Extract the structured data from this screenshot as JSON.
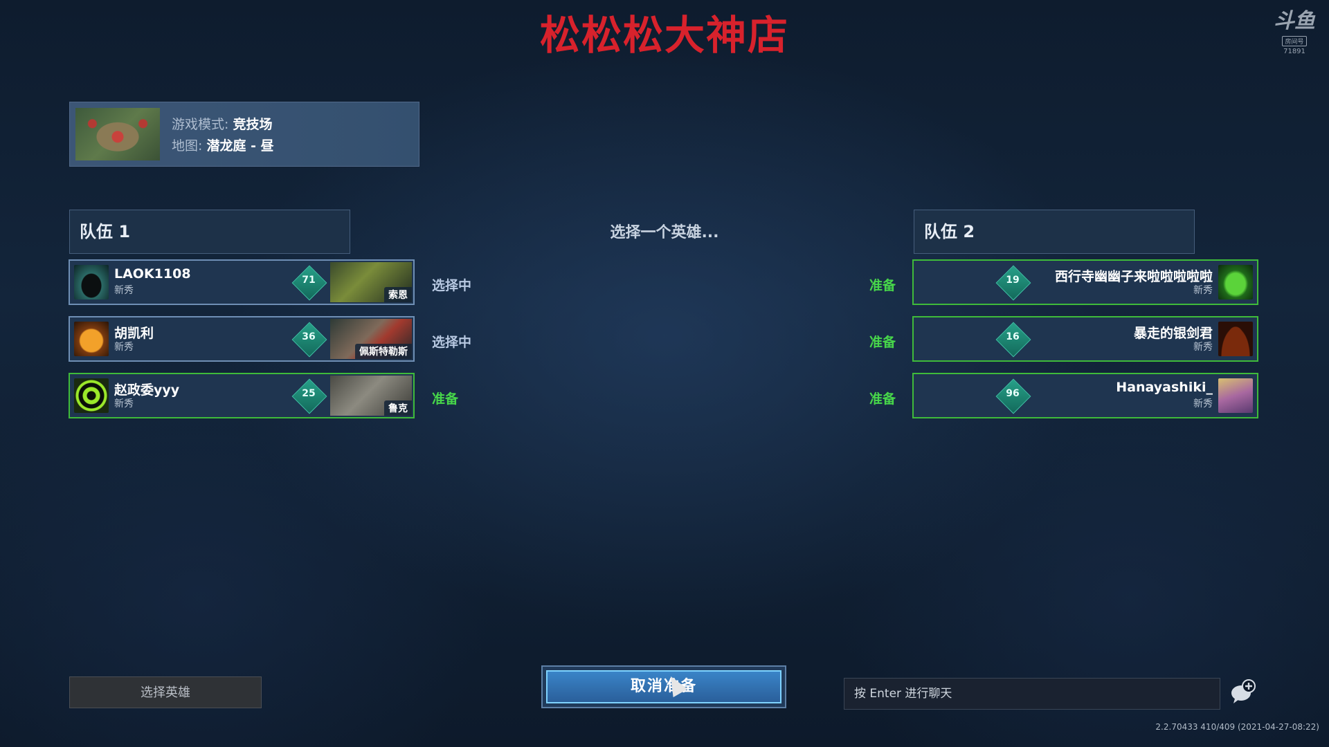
{
  "stream": {
    "title": "松松松大神店"
  },
  "watermark": {
    "logo_text": "斗鱼",
    "sub": "房间号",
    "room_id": "71891"
  },
  "game_info": {
    "mode_label": "游戏模式: ",
    "mode_value": "竞技场",
    "map_label": "地图: ",
    "map_value": "潜龙庭 - 昼"
  },
  "center": {
    "prompt": "选择一个英雄..."
  },
  "team1": {
    "header": "队伍 1",
    "players": [
      {
        "name": "LAOK1108",
        "rank": "新秀",
        "level": "71",
        "hero": "索恩",
        "status": "选择中",
        "status_type": "selecting",
        "avatar_icon": "grin-avatar-icon"
      },
      {
        "name": "胡凯利",
        "rank": "新秀",
        "level": "36",
        "hero": "佩斯特勒斯",
        "status": "选择中",
        "status_type": "selecting",
        "avatar_icon": "pumpkin-avatar-icon"
      },
      {
        "name": "赵政委yyy",
        "rank": "新秀",
        "level": "25",
        "hero": "鲁克",
        "status": "准备",
        "status_type": "ready",
        "avatar_icon": "biohazard-avatar-icon"
      }
    ]
  },
  "team2": {
    "header": "队伍 2",
    "players": [
      {
        "name": "西行寺幽幽子来啦啦啦啦啦",
        "rank": "新秀",
        "level": "19",
        "status": "准备",
        "status_type": "ready",
        "avatar_icon": "frog-avatar-icon"
      },
      {
        "name": "暴走的银剑君",
        "rank": "新秀",
        "level": "16",
        "status": "准备",
        "status_type": "ready",
        "avatar_icon": "silhouette-avatar-icon"
      },
      {
        "name": "Hanayashiki_",
        "rank": "新秀",
        "level": "96",
        "status": "准备",
        "status_type": "ready",
        "avatar_icon": "anime-girl-avatar-icon"
      }
    ]
  },
  "buttons": {
    "pick_hero": "选择英雄",
    "cancel_ready": "取消准备"
  },
  "chat": {
    "placeholder": "按 Enter 进行聊天"
  },
  "footer": {
    "version": "2.2.70433 410/409 (2021-04-27-08:22)"
  },
  "colors": {
    "title_red": "#d8222c",
    "ready_green": "#47d64a",
    "ready_border": "#3fbb3a",
    "selecting_border": "#6f8fb5"
  }
}
